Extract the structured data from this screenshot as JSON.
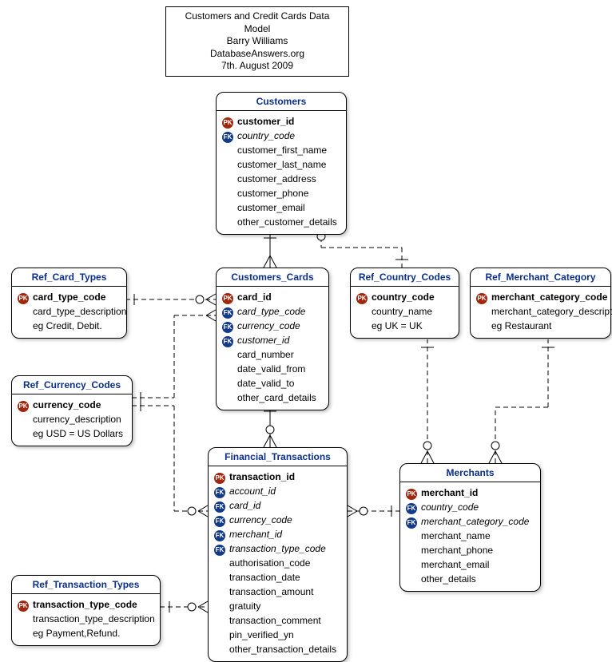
{
  "title": {
    "line1": "Customers and Credit  Cards Data Model",
    "line2": "Barry Williams",
    "line3": "DatabaseAnswers.org",
    "line4": "7th. August 2009"
  },
  "entities": {
    "customers": {
      "name": "Customers",
      "attrs": [
        {
          "key": "pk",
          "name": "customer_id"
        },
        {
          "key": "fk",
          "name": "country_code"
        },
        {
          "key": "",
          "name": "customer_first_name"
        },
        {
          "key": "",
          "name": "customer_last_name"
        },
        {
          "key": "",
          "name": "customer_address"
        },
        {
          "key": "",
          "name": "customer_phone"
        },
        {
          "key": "",
          "name": "customer_email"
        },
        {
          "key": "",
          "name": "other_customer_details"
        }
      ]
    },
    "customers_cards": {
      "name": "Customers_Cards",
      "attrs": [
        {
          "key": "pk",
          "name": "card_id"
        },
        {
          "key": "fk",
          "name": "card_type_code"
        },
        {
          "key": "fk",
          "name": "currency_code"
        },
        {
          "key": "fk",
          "name": "customer_id"
        },
        {
          "key": "",
          "name": "card_number"
        },
        {
          "key": "",
          "name": "date_valid_from"
        },
        {
          "key": "",
          "name": "date_valid_to"
        },
        {
          "key": "",
          "name": "other_card_details"
        }
      ]
    },
    "ref_card_types": {
      "name": "Ref_Card_Types",
      "attrs": [
        {
          "key": "pk",
          "name": "card_type_code"
        },
        {
          "key": "",
          "name": "card_type_description"
        },
        {
          "key": "",
          "name": "eg Credit, Debit."
        }
      ]
    },
    "ref_country_codes": {
      "name": "Ref_Country_Codes",
      "attrs": [
        {
          "key": "pk",
          "name": "country_code"
        },
        {
          "key": "",
          "name": "country_name"
        },
        {
          "key": "",
          "name": "eg UK = UK"
        }
      ]
    },
    "ref_merchant_category": {
      "name": "Ref_Merchant_Category",
      "attrs": [
        {
          "key": "pk",
          "name": "merchant_category_code"
        },
        {
          "key": "",
          "name": "merchant_category_description"
        },
        {
          "key": "",
          "name": "eg Restaurant"
        }
      ]
    },
    "ref_currency_codes": {
      "name": "Ref_Currency_Codes",
      "attrs": [
        {
          "key": "pk",
          "name": "currency_code"
        },
        {
          "key": "",
          "name": "currency_description"
        },
        {
          "key": "",
          "name": "eg USD = US Dollars"
        }
      ]
    },
    "financial_transactions": {
      "name": "Financial_Transactions",
      "attrs": [
        {
          "key": "pk",
          "name": "transaction_id"
        },
        {
          "key": "fk",
          "name": "account_id"
        },
        {
          "key": "fk",
          "name": "card_id"
        },
        {
          "key": "fk",
          "name": "currency_code"
        },
        {
          "key": "fk",
          "name": "merchant_id"
        },
        {
          "key": "fk",
          "name": "transaction_type_code"
        },
        {
          "key": "",
          "name": "authorisation_code"
        },
        {
          "key": "",
          "name": "transaction_date"
        },
        {
          "key": "",
          "name": "transaction_amount"
        },
        {
          "key": "",
          "name": "gratuity"
        },
        {
          "key": "",
          "name": "transaction_comment"
        },
        {
          "key": "",
          "name": "pin_verified_yn"
        },
        {
          "key": "",
          "name": "other_transaction_details"
        }
      ]
    },
    "merchants": {
      "name": "Merchants",
      "attrs": [
        {
          "key": "pk",
          "name": "merchant_id"
        },
        {
          "key": "fk",
          "name": "country_code"
        },
        {
          "key": "fk",
          "name": "merchant_category_code"
        },
        {
          "key": "",
          "name": "merchant_name"
        },
        {
          "key": "",
          "name": "merchant_phone"
        },
        {
          "key": "",
          "name": "merchant_email"
        },
        {
          "key": "",
          "name": "other_details"
        }
      ]
    },
    "ref_transaction_types": {
      "name": "Ref_Transaction_Types",
      "attrs": [
        {
          "key": "pk",
          "name": "transaction_type_code"
        },
        {
          "key": "",
          "name": "transaction_type_description"
        },
        {
          "key": "",
          "name": "eg Payment,Refund."
        }
      ]
    }
  }
}
